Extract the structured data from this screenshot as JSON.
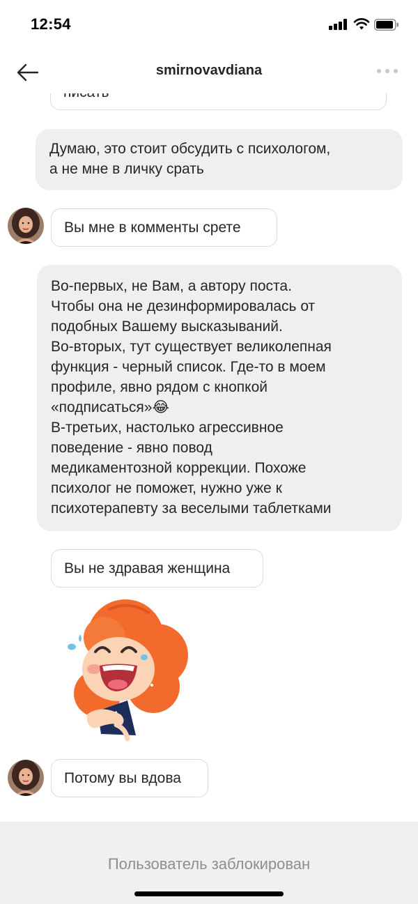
{
  "status_bar": {
    "time": "12:54"
  },
  "header": {
    "title": "smirnovavdiana"
  },
  "messages": [
    {
      "direction": "incoming",
      "lines": [
        "писать"
      ]
    },
    {
      "direction": "outgoing",
      "lines": [
        "Думаю, это стоит обсудить с психологом,",
        "а не мне в личку срать"
      ]
    },
    {
      "direction": "incoming",
      "lines": [
        "Вы мне в комменты срете"
      ]
    },
    {
      "direction": "outgoing",
      "lines": [
        "Во-первых, не Вам, а автору поста.",
        "Чтобы она не дезинформировалась от",
        "подобных Вашему высказываний.",
        "Во-вторых, тут существует великолепная",
        "функция - черный список. Где-то в моем",
        "профиле, явно рядом с кнопкой",
        "«подписаться»😂",
        "В-третьих, настолько агрессивное",
        "поведение - явно повод",
        "медикаментозной коррекции. Похоже",
        "психолог не поможет, нужно уже к",
        "психотерапевту за веселыми таблетками"
      ]
    },
    {
      "direction": "incoming",
      "lines": [
        "Вы не здравая женщина"
      ]
    },
    {
      "direction": "incoming",
      "type": "sticker",
      "icon": "laughing-girl-sticker"
    },
    {
      "direction": "incoming",
      "lines": [
        "Потому вы вдова"
      ]
    }
  ],
  "footer": {
    "blocked_label": "Пользователь заблокирован"
  },
  "colors": {
    "outgoing_bubble": "#efefef",
    "incoming_border": "#dbdbdb",
    "footer_bg": "#f0f0f0",
    "muted_text": "#8e8e8e"
  }
}
